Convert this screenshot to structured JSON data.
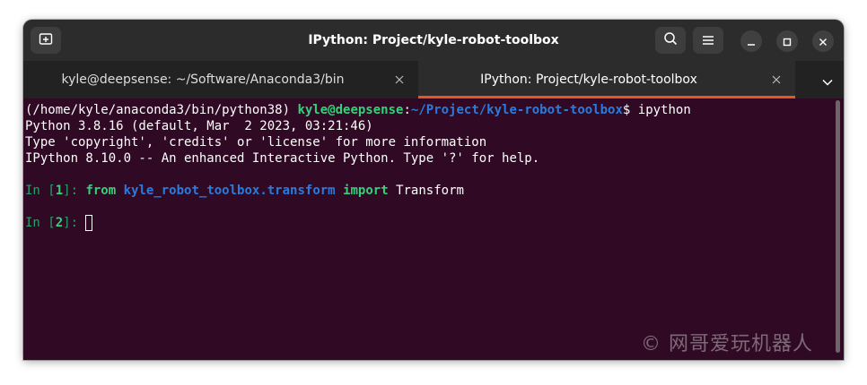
{
  "window": {
    "title": "IPython: Project/kyle-robot-toolbox"
  },
  "titlebar": {
    "new_tab_icon": "new-tab-icon",
    "search_icon": "search-icon",
    "menu_icon": "hamburger-menu-icon",
    "minimize_icon": "minimize-icon",
    "maximize_icon": "maximize-icon",
    "close_icon": "close-icon"
  },
  "tabs": [
    {
      "label": "kyle@deepsense: ~/Software/Anaconda3/bin",
      "active": false
    },
    {
      "label": "IPython: Project/kyle-robot-toolbox",
      "active": true
    }
  ],
  "colors": {
    "terminal_bg": "#300a24",
    "prompt_green": "#26a269",
    "user_host_green": "#33d17a",
    "path_blue": "#2a7bde",
    "tab_accent": "#e95420"
  },
  "terminal": {
    "line1": {
      "env": "(/home/kyle/anaconda3/bin/python38) ",
      "user_host": "kyle@deepsense",
      "colon": ":",
      "path": "~/Project/kyle-robot-toolbox",
      "command": "$ ipython"
    },
    "line2": "Python 3.8.16 (default, Mar  2 2023, 03:21:46)",
    "line3": "Type 'copyright', 'credits' or 'license' for more information",
    "line4": "IPython 8.10.0 -- An enhanced Interactive Python. Type '?' for help.",
    "in1": {
      "prefix": "In [",
      "num": "1",
      "suffix": "]: ",
      "kw_from": "from",
      "module": "kyle_robot_toolbox.transform",
      "kw_import": "import",
      "name": "Transform"
    },
    "in2": {
      "prefix": "In [",
      "num": "2",
      "suffix": "]: "
    }
  },
  "watermark": "© 网哥爱玩机器人"
}
